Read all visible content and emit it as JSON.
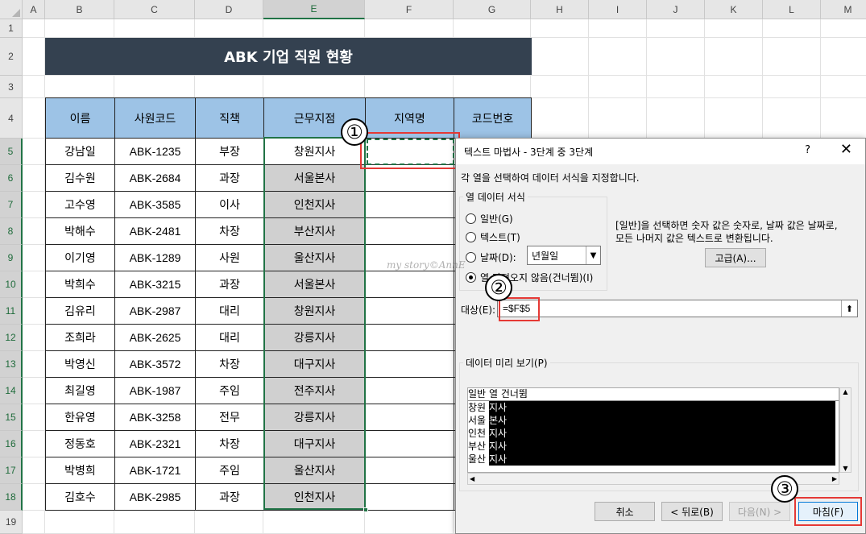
{
  "sheet": {
    "columns": [
      "A",
      "B",
      "C",
      "D",
      "E",
      "F",
      "G",
      "H",
      "I",
      "J",
      "K",
      "L",
      "M"
    ],
    "rows": [
      "1",
      "2",
      "3",
      "4",
      "5",
      "6",
      "7",
      "8",
      "9",
      "10",
      "11",
      "12",
      "13",
      "14",
      "15",
      "16",
      "17",
      "18",
      "19"
    ],
    "title": "ABK 기업 직원 현황",
    "headers": [
      "이름",
      "사원코드",
      "직책",
      "근무지점",
      "지역명",
      "코드번호"
    ],
    "records": [
      [
        "강남일",
        "ABK-1235",
        "부장",
        "창원지사"
      ],
      [
        "김수원",
        "ABK-2684",
        "과장",
        "서울본사"
      ],
      [
        "고수영",
        "ABK-3585",
        "이사",
        "인천지사"
      ],
      [
        "박해수",
        "ABK-2481",
        "차장",
        "부산지사"
      ],
      [
        "이기영",
        "ABK-1289",
        "사원",
        "울산지사"
      ],
      [
        "박희수",
        "ABK-3215",
        "과장",
        "서울본사"
      ],
      [
        "김유리",
        "ABK-2987",
        "대리",
        "창원지사"
      ],
      [
        "조희라",
        "ABK-2625",
        "대리",
        "강릉지사"
      ],
      [
        "박영신",
        "ABK-3572",
        "차장",
        "대구지사"
      ],
      [
        "최길영",
        "ABK-1987",
        "주임",
        "전주지사"
      ],
      [
        "한유영",
        "ABK-3258",
        "전무",
        "강릉지사"
      ],
      [
        "정동호",
        "ABK-2321",
        "차장",
        "대구지사"
      ],
      [
        "박병희",
        "ABK-1721",
        "주임",
        "울산지사"
      ],
      [
        "김호수",
        "ABK-2985",
        "과장",
        "인천지사"
      ]
    ]
  },
  "markers": {
    "m1": "①",
    "m2": "②",
    "m3": "③"
  },
  "watermark": "my story©AnnE",
  "dialog": {
    "title": "텍스트 마법사 - 3단계 중 3단계",
    "help": "?",
    "close": "✕",
    "instruction": "각 열을 선택하여 데이터 서식을 지정합니다.",
    "format_group": "열 데이터 서식",
    "opt_general": "일반(G)",
    "opt_text": "텍스트(T)",
    "opt_date": "날짜(D):",
    "opt_skip": "열 가져오지 않음(건너뜀)(I)",
    "date_value": "년월일",
    "desc_line1": "[일반]을 선택하면 숫자 값은 숫자로, 날짜 값은 날짜로,",
    "desc_line2": "모든 나머지 값은 텍스트로 변환됩니다.",
    "advanced": "고급(A)...",
    "dest_label": "대상(E):",
    "dest_value": "=$F$5",
    "preview_group": "데이터 미리 보기(P)",
    "preview_head1": "일반",
    "preview_head2": "열 건너뜀",
    "preview_rows": [
      [
        "창원",
        "지사"
      ],
      [
        "서울",
        "본사"
      ],
      [
        "인천",
        "지사"
      ],
      [
        "부산",
        "지사"
      ],
      [
        "울산",
        "지사"
      ]
    ],
    "btn_cancel": "취소",
    "btn_back": "< 뒤로(B)",
    "btn_next": "다음(N) >",
    "btn_finish": "마침(F)"
  },
  "colors": {
    "title_bg": "#344150",
    "header_bg": "#9dc3e6",
    "gray_cell": "#d0d0d0",
    "selection": "#217346",
    "highlight": "#e53935"
  }
}
